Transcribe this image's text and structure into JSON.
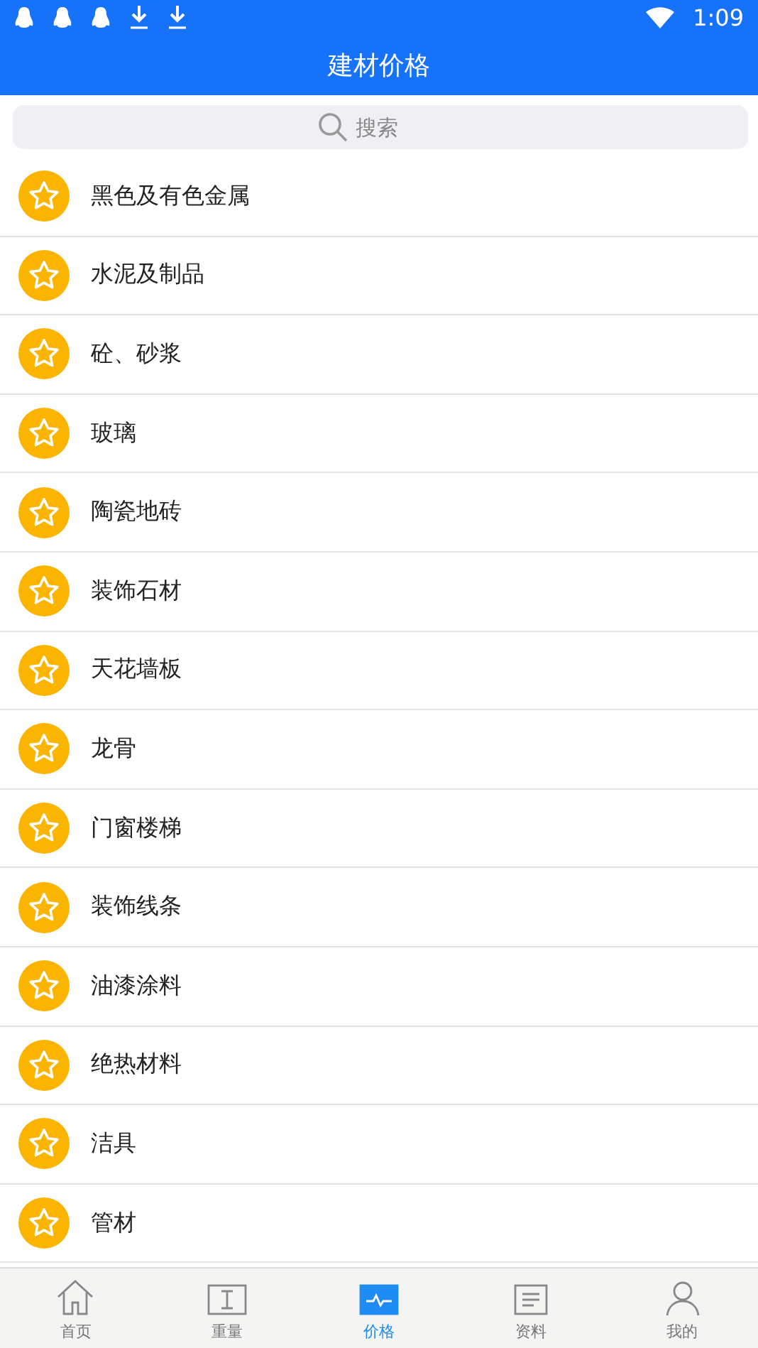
{
  "status_bar": {
    "time": "1:09"
  },
  "title": "建材价格",
  "search": {
    "placeholder": "搜索"
  },
  "categories": [
    {
      "label": "黑色及有色金属"
    },
    {
      "label": "水泥及制品"
    },
    {
      "label": "砼、砂浆"
    },
    {
      "label": "玻璃"
    },
    {
      "label": "陶瓷地砖"
    },
    {
      "label": "装饰石材"
    },
    {
      "label": "天花墙板"
    },
    {
      "label": "龙骨"
    },
    {
      "label": "门窗楼梯"
    },
    {
      "label": "装饰线条"
    },
    {
      "label": "油漆涂料"
    },
    {
      "label": "绝热材料"
    },
    {
      "label": "洁具"
    },
    {
      "label": "管材"
    }
  ],
  "tabs": [
    {
      "label": "首页",
      "kind": "home",
      "selected": false
    },
    {
      "label": "重量",
      "kind": "weight",
      "selected": false
    },
    {
      "label": "价格",
      "kind": "price",
      "selected": true
    },
    {
      "label": "资料",
      "kind": "docs",
      "selected": false
    },
    {
      "label": "我的",
      "kind": "me",
      "selected": false
    }
  ]
}
